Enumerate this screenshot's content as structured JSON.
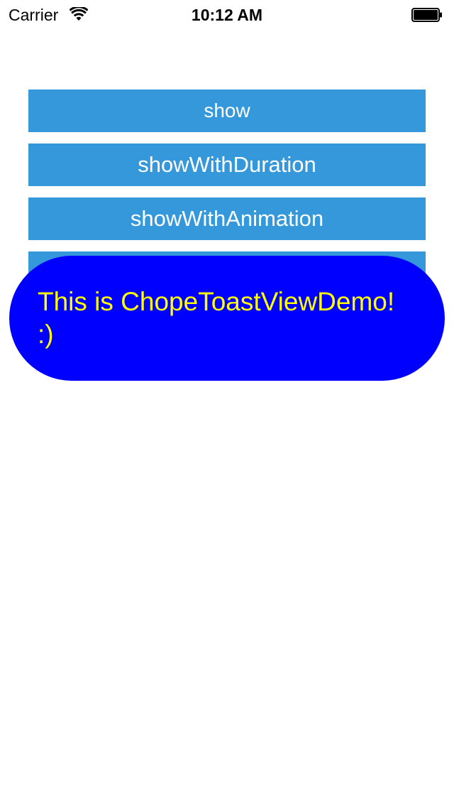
{
  "status_bar": {
    "carrier": "Carrier",
    "time": "10:12 AM",
    "wifi_icon": "wifi-icon",
    "battery_icon": "battery-icon"
  },
  "buttons": {
    "show": "show",
    "show_with_duration": "showWithDuration",
    "show_with_animation": "showWithAnimation",
    "fourth": ""
  },
  "toast": {
    "line1": "This is ChopeToastViewDemo!",
    "line2": ":)",
    "background_color": "#0000ff",
    "text_color": "#ffff00"
  },
  "colors": {
    "button_background": "#3498db",
    "button_text": "#ffffff"
  }
}
